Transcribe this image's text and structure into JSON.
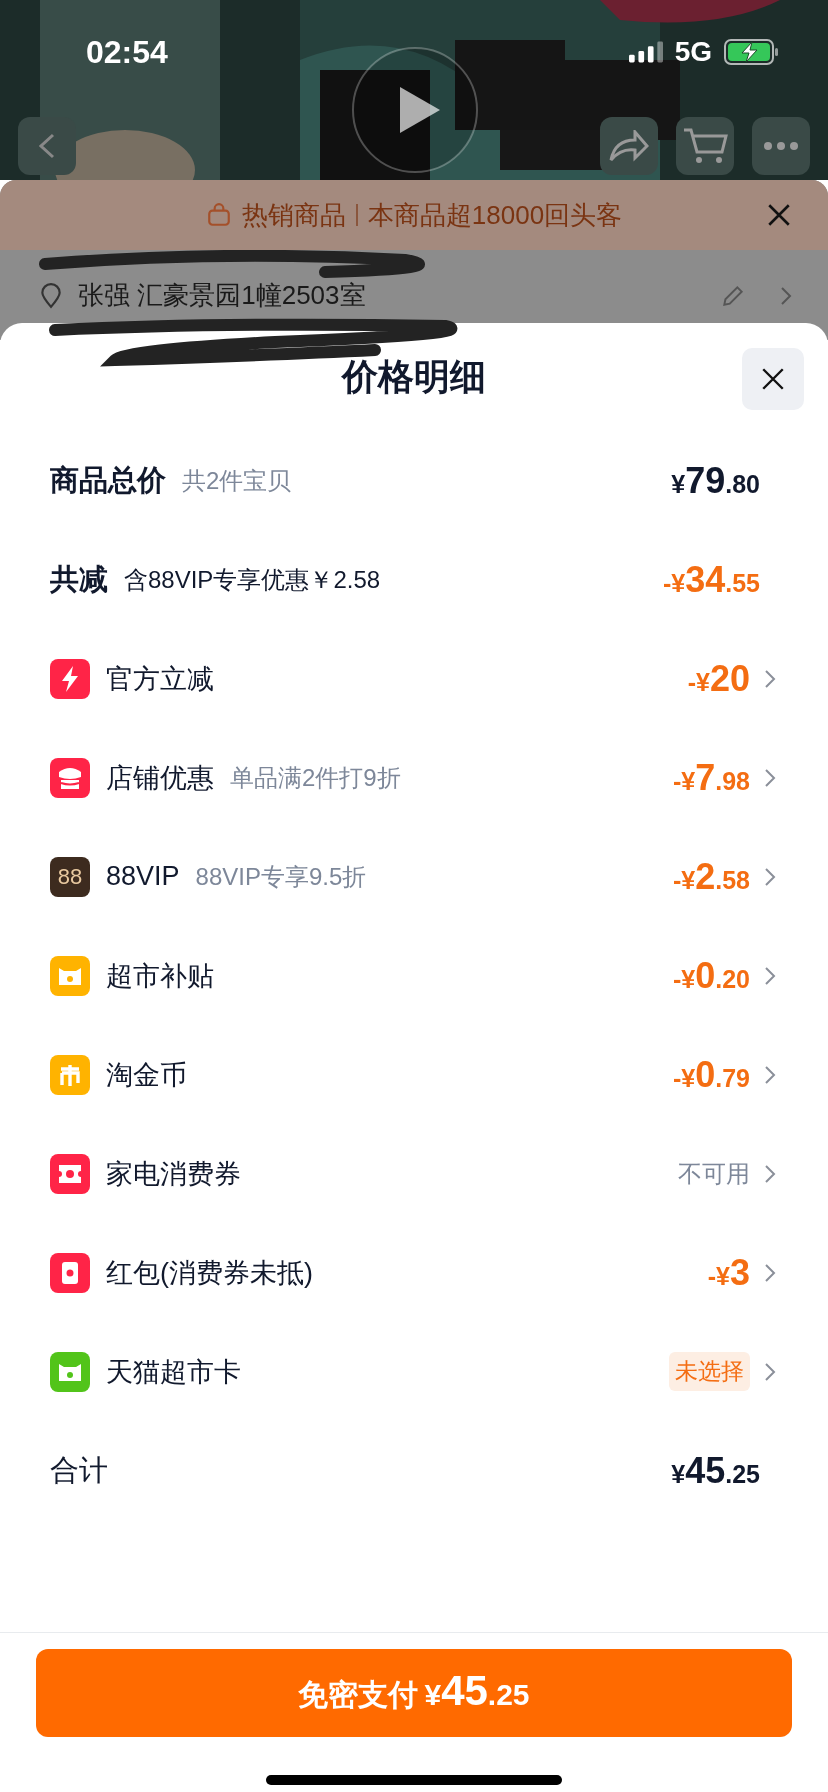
{
  "status_bar": {
    "time": "02:54",
    "network": "5G"
  },
  "background_page": {
    "banner": {
      "label": "热销商品",
      "text": "本商品超18000回头客"
    },
    "address": "张强 汇豪景园1幢2503室"
  },
  "sheet": {
    "title": "价格明细",
    "summary": [
      {
        "label": "商品总价",
        "note": "共2件宝贝",
        "amount": "¥79.80",
        "kind": "total"
      },
      {
        "label": "共减",
        "note": "含88VIP专享优惠￥2.58",
        "amount": "-¥34.55",
        "kind": "discount"
      }
    ],
    "items": [
      {
        "label": "官方立减",
        "value": "-¥20",
        "kind": "discount",
        "color": "#ff2447"
      },
      {
        "label": "店铺优惠",
        "note": "单品满2件打9折",
        "value": "-¥7.98",
        "kind": "discount",
        "color": "#ff2447"
      },
      {
        "label": "88VIP",
        "note": "88VIP专享9.5折",
        "value": "-¥2.58",
        "kind": "discount",
        "color": "#3d2b1f",
        "icon_text": "88"
      },
      {
        "label": "超市补贴",
        "value": "-¥0.20",
        "kind": "discount",
        "color": "#ffb300"
      },
      {
        "label": "淘金币",
        "value": "-¥0.79",
        "kind": "discount",
        "color": "#ffb300"
      },
      {
        "label": "家电消费券",
        "value": "不可用",
        "kind": "unavailable",
        "color": "#ff2447"
      },
      {
        "label": "红包(消费券未抵)",
        "value": "-¥3",
        "kind": "discount",
        "color": "#ff2447"
      },
      {
        "label": "天猫超市卡",
        "value": "未选择",
        "kind": "unselected",
        "color": "#52c41a"
      }
    ],
    "total": {
      "label": "合计",
      "amount": "¥45.25"
    },
    "pay_button": {
      "label": "免密支付",
      "amount": "¥45.25"
    }
  }
}
